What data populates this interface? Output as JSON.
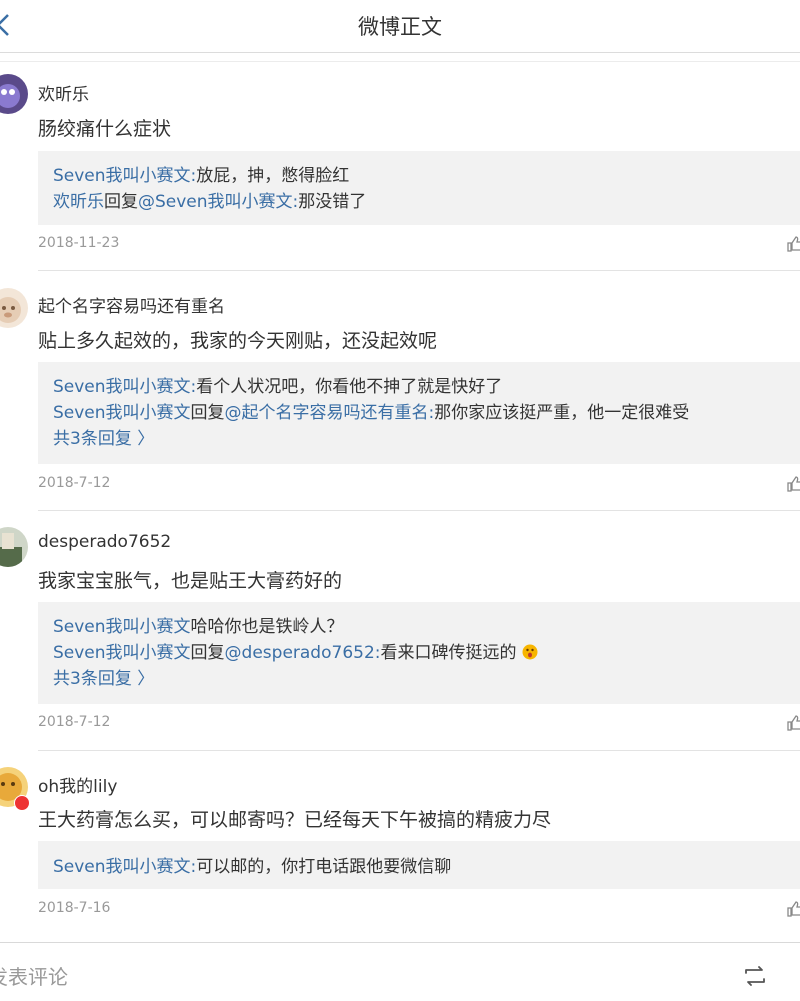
{
  "header": {
    "title": "微博正文"
  },
  "comments": [
    {
      "user": "欢昕乐",
      "text": "肠绞痛什么症状",
      "replies": [
        {
          "author": "Seven我叫小赛文",
          "sep": ":",
          "text": "放屁，抻，憋得脸红"
        },
        {
          "author": "欢昕乐",
          "verb": "回复",
          "mention": "@Seven我叫小赛文",
          "sep": ":",
          "text": "那没错了"
        }
      ],
      "date": "2018-11-23"
    },
    {
      "user": "起个名字容易吗还有重名",
      "text": "贴上多久起效的，我家的今天刚贴，还没起效呢",
      "replies": [
        {
          "author": "Seven我叫小赛文",
          "sep": ":",
          "text": "看个人状况吧，你看他不抻了就是快好了"
        },
        {
          "author": "Seven我叫小赛文",
          "verb": "回复",
          "mention": "@起个名字容易吗还有重名",
          "sep": ":",
          "text": "那你家应该挺严重，他一定很难受"
        }
      ],
      "more": "共3条回复 〉",
      "date": "2018-7-12"
    },
    {
      "user": "desperado7652",
      "text": "我家宝宝胀气，也是贴王大膏药好的",
      "replies": [
        {
          "author": "Seven我叫小赛文",
          "sep": ":",
          "text": "哈哈你也是铁岭人？"
        },
        {
          "author": "Seven我叫小赛文",
          "verb": "回复",
          "mention": "@desperado7652",
          "sep": ":",
          "text": "看来口碑传挺远的"
        }
      ],
      "more": "共3条回复 〉",
      "date": "2018-7-12"
    },
    {
      "user": "oh我的lily",
      "text": "王大药膏怎么买，可以邮寄吗？已经每天下午被搞的精疲力尽",
      "replies": [
        {
          "author": "Seven我叫小赛文",
          "sep": ":",
          "text": "可以邮的，你打电话跟他要微信聊"
        }
      ],
      "date": "2018-7-16"
    }
  ],
  "footer": {
    "comment_placeholder": "发表评论"
  },
  "colors": {
    "link": "#3a6ea5",
    "reply_bg": "#f2f2f2",
    "date": "#999999"
  },
  "icons": {
    "back": "chevron-left-icon",
    "like": "thumbs-up-icon",
    "repost": "repost-icon"
  }
}
